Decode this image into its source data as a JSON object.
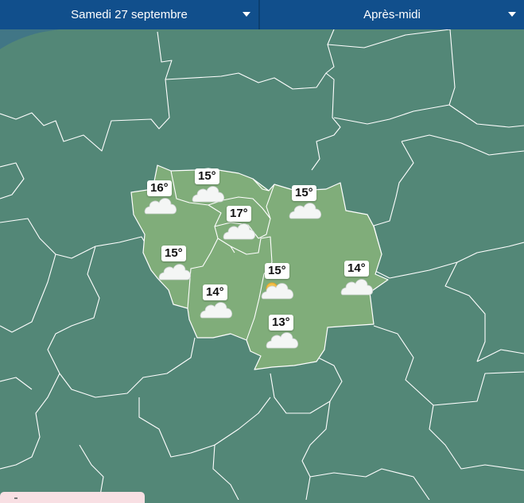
{
  "header": {
    "date_select": "Samedi 27 septembre",
    "period_select": "Après-midi"
  },
  "colors": {
    "map_background": "#538777",
    "region_highlight": "#80ad7a",
    "borders": "#ffffff",
    "header_bar": "#114f8c"
  },
  "forecasts": [
    {
      "temp": "16°",
      "icon": "cloud-icon"
    },
    {
      "temp": "15°",
      "icon": "cloud-icon"
    },
    {
      "temp": "17°",
      "icon": "cloud-icon"
    },
    {
      "temp": "15°",
      "icon": "cloud-icon"
    },
    {
      "temp": "15°",
      "icon": "cloud-icon"
    },
    {
      "temp": "14°",
      "icon": "cloud-icon"
    },
    {
      "temp": "15°",
      "icon": "sun-cloud-icon"
    },
    {
      "temp": "14°",
      "icon": "cloud-icon"
    },
    {
      "temp": "13°",
      "icon": "cloud-icon"
    }
  ]
}
